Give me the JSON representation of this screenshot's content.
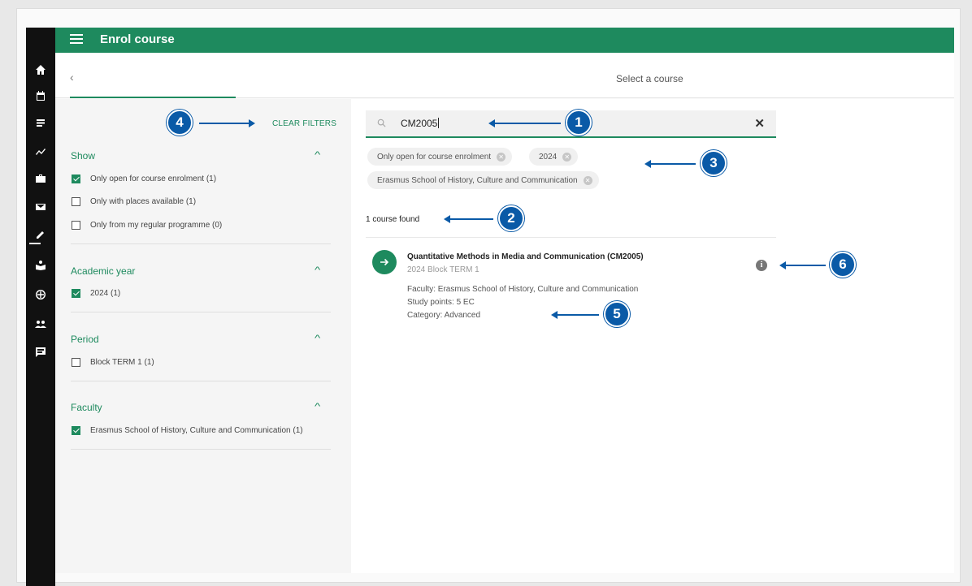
{
  "appbar": {
    "title": "Enrol course"
  },
  "subbar": {
    "back": "‹",
    "heading": "Select a course"
  },
  "filters": {
    "clear_label": "CLEAR FILTERS",
    "sections": [
      {
        "title": "Show",
        "options": [
          {
            "label": "Only open for course enrolment (1)",
            "checked": true
          },
          {
            "label": "Only with places available (1)",
            "checked": false
          },
          {
            "label": "Only from my regular programme (0)",
            "checked": false
          }
        ]
      },
      {
        "title": "Academic year",
        "options": [
          {
            "label": "2024 (1)",
            "checked": true
          }
        ]
      },
      {
        "title": "Period",
        "options": [
          {
            "label": "Block TERM 1 (1)",
            "checked": false
          }
        ]
      },
      {
        "title": "Faculty",
        "options": [
          {
            "label": "Erasmus School of History, Culture and Communication (1)",
            "checked": true
          }
        ]
      }
    ]
  },
  "search": {
    "value": "CM2005",
    "clear_icon": "✕"
  },
  "chips": [
    "Only open for course enrolment",
    "2024",
    "Erasmus School of History, Culture and Communication"
  ],
  "result_count": "1 course found",
  "course": {
    "title": "Quantitative Methods in Media and Communication (CM2005)",
    "subtitle": "2024 Block TERM 1",
    "faculty": "Faculty: Erasmus School of History, Culture and Communication",
    "points": "Study points: 5 EC",
    "category": "Category: Advanced"
  },
  "callouts": [
    "1",
    "2",
    "3",
    "4",
    "5",
    "6"
  ],
  "colors": {
    "brand": "#1e8a5e",
    "callout": "#0a5aa7",
    "rail": "#111111"
  },
  "rail_icons": [
    "home-icon",
    "calendar-icon",
    "list-icon",
    "trend-icon",
    "briefcase-icon",
    "mail-icon",
    "edit-icon",
    "school-icon",
    "globe-icon",
    "people-icon",
    "feedback-icon"
  ]
}
